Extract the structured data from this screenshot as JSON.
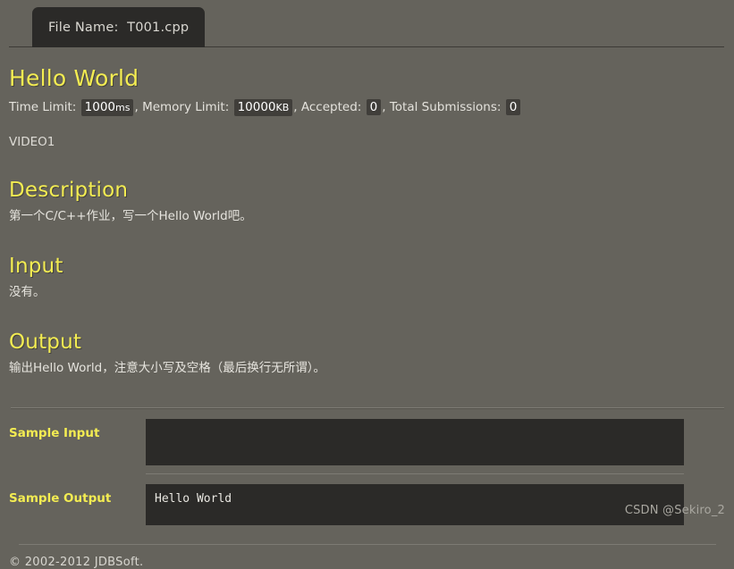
{
  "tab": {
    "label": "File Name:  T001.cpp",
    "file_label": "File Name:",
    "file_name": "T001.cpp"
  },
  "problem": {
    "title": "Hello World",
    "meta": {
      "time_limit_label": "Time Limit:",
      "time_limit_value": "1000",
      "time_limit_unit": "ms",
      "sep1": ", ",
      "memory_limit_label": "Memory Limit:",
      "memory_limit_value": "10000",
      "memory_limit_unit": "KB",
      "sep2": ", ",
      "accepted_label": "Accepted:",
      "accepted_value": "0",
      "sep3": ", ",
      "total_submissions_label": "Total Submissions:",
      "total_submissions_value": "0"
    },
    "video_link": "VIDEO1"
  },
  "sections": {
    "description_heading": "Description",
    "description_text": "第一个C/C++作业，写一个Hello World吧。",
    "input_heading": "Input",
    "input_text": "没有。",
    "output_heading": "Output",
    "output_text": "输出Hello World，注意大小写及空格（最后换行无所谓）。"
  },
  "samples": {
    "input_label": "Sample Input",
    "input_value": "",
    "output_label": "Sample Output",
    "output_value": "Hello World"
  },
  "footer": {
    "copyright": "© 2002-2012  JDBSoft.",
    "watermark": "CSDN @Sekiro_2"
  },
  "colors": {
    "background": "#65635c",
    "panel_dark": "#2b2a28",
    "accent_yellow": "#f3ec52",
    "text_light": "#e6e4de",
    "badge_bg": "#403e3a"
  }
}
